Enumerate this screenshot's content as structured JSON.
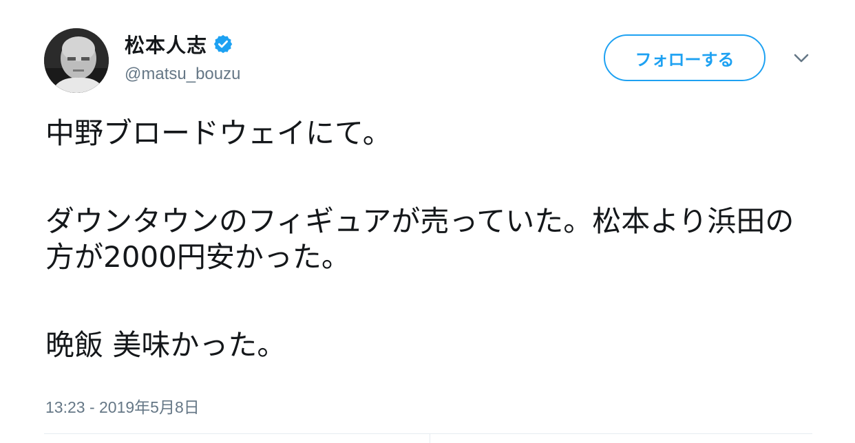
{
  "tweet": {
    "author": {
      "display_name": "松本人志",
      "handle": "@matsu_bouzu",
      "verified": true,
      "avatar_icon": "user-avatar-photo"
    },
    "follow_button_label": "フォローする",
    "more_menu_icon": "chevron-down-icon",
    "text": {
      "paragraph1": "中野ブロードウェイにて。",
      "paragraph2": "ダウンタウンのフィギュアが売っていた。松本より浜田の方が2000円安かった。",
      "paragraph3": "晩飯 美味かった。"
    },
    "timestamp": "13:23 - 2019年5月8日"
  },
  "colors": {
    "accent": "#1da1f2",
    "text_primary": "#14171a",
    "text_secondary": "#657786",
    "divider": "#e6ecf0"
  }
}
